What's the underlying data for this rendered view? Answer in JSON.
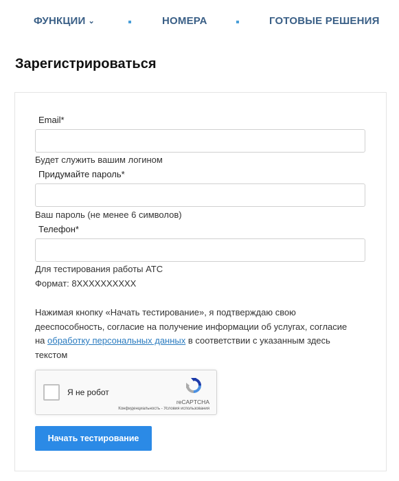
{
  "nav": {
    "items": [
      {
        "label": "ФУНКЦИИ"
      },
      {
        "label": "НОМЕРА"
      },
      {
        "label": "ГОТОВЫЕ РЕШЕНИЯ"
      }
    ],
    "chevron": "⌄"
  },
  "page": {
    "title": "Зарегистрироваться"
  },
  "form": {
    "email": {
      "label": "Email*",
      "value": "",
      "placeholder": "",
      "hint": "Будет служить вашим логином"
    },
    "password": {
      "label": "Придумайте пароль*",
      "value": "",
      "placeholder": "",
      "hint": "Ваш пароль (не менее 6 символов)"
    },
    "phone": {
      "label": "Телефон*",
      "value": "",
      "placeholder": "",
      "hint_line1": "Для тестирования работы АТС",
      "hint_line2": "Формат: 8XXXXXXXXXX"
    },
    "consent": {
      "text_before": "Нажимая кнопку «Начать тестирование», я подтверждаю свою дееспособность, согласие на получение информации об услугах, согласие на ",
      "link": "обработку персональных данных",
      "text_after": " в соответствии с указанным здесь текстом"
    },
    "captcha": {
      "label": "Я не робот",
      "brand": "reCAPTCHA",
      "links": "Конфиденциальность - Условия использования"
    },
    "submit_label": "Начать тестирование"
  },
  "colors": {
    "nav_text": "#3a5f86",
    "nav_dot": "#4a9fd8",
    "link": "#2a7bbf",
    "button": "#2b8ae6"
  }
}
